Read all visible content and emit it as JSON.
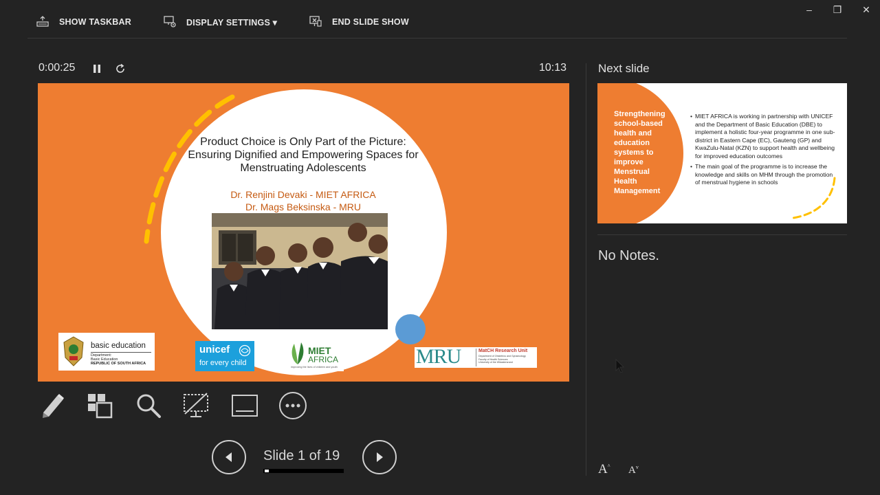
{
  "window": {
    "minimize": "–",
    "restore": "❐",
    "close": "✕"
  },
  "toolbar": {
    "show_taskbar": "SHOW TASKBAR",
    "display_settings": "DISPLAY SETTINGS ▾",
    "end_slide_show": "END SLIDE SHOW"
  },
  "presenter": {
    "elapsed": "0:00:25",
    "clock": "10:13",
    "slide_counter": "Slide 1 of 19",
    "progress_fraction": 0.0526
  },
  "current_slide": {
    "title": "Product Choice is Only Part of the Picture: Ensuring Dignified and Empowering Spaces for Menstruating Adolescents",
    "author1": "Dr. Renjini Devaki -  MIET AFRICA",
    "author2": "Dr. Mags Beksinska -  MRU",
    "logos": {
      "basic_education": "basic education",
      "basic_education_sub1": "Department:",
      "basic_education_sub2": "Basic Education",
      "basic_education_sub3": "REPUBLIC OF SOUTH AFRICA",
      "unicef": "unicef",
      "unicef_tag": "for every child",
      "miet_1": "MIET",
      "miet_2": "AFRICA",
      "miet_tag": "improving the lives of children and youth",
      "mru": "MRU",
      "match_title": "MatCH Research Unit",
      "match_sub1": "Department of Obstetrics and Gynaecology",
      "match_sub2": "Faculty of Health Sciences",
      "match_sub3": "University of the Witwatersrand"
    }
  },
  "next_slide": {
    "label": "Next slide",
    "title": "Strengthening school-based health and education systems to improve Menstrual Health Management",
    "bullet1": "MIET AFRICA is working in partnership with UNICEF and the Department of Basic Education (DBE) to implement a holistic four-year programme in one sub-district in Eastern Cape (EC), Gauteng (GP) and KwaZulu-Natal (KZN) to support health and wellbeing for improved education outcomes",
    "bullet2": "The main goal of the programme is to increase the knowledge and skills on MHM through the promotion of menstrual hygiene in schools"
  },
  "notes": {
    "text": "No Notes."
  },
  "font_controls": {
    "increase": "A",
    "decrease": "A"
  },
  "colors": {
    "background": "#232323",
    "slide_orange": "#ee7d31",
    "accent_yellow": "#ffc000",
    "dot_blue": "#5b9bd5"
  },
  "icons": {
    "show_taskbar": "taskbar-icon",
    "display_settings": "monitor-gear-icon",
    "end_slide_show": "end-show-icon",
    "pause": "pause-icon",
    "restart": "restart-icon",
    "pen": "pen-icon",
    "see_all_slides": "slides-grid-icon",
    "zoom": "magnifier-icon",
    "black_screen": "black-screen-icon",
    "subtitles": "subtitles-icon",
    "more": "more-options-icon",
    "previous": "previous-arrow-icon",
    "next": "next-arrow-icon",
    "cursor": "mouse-pointer-icon"
  }
}
